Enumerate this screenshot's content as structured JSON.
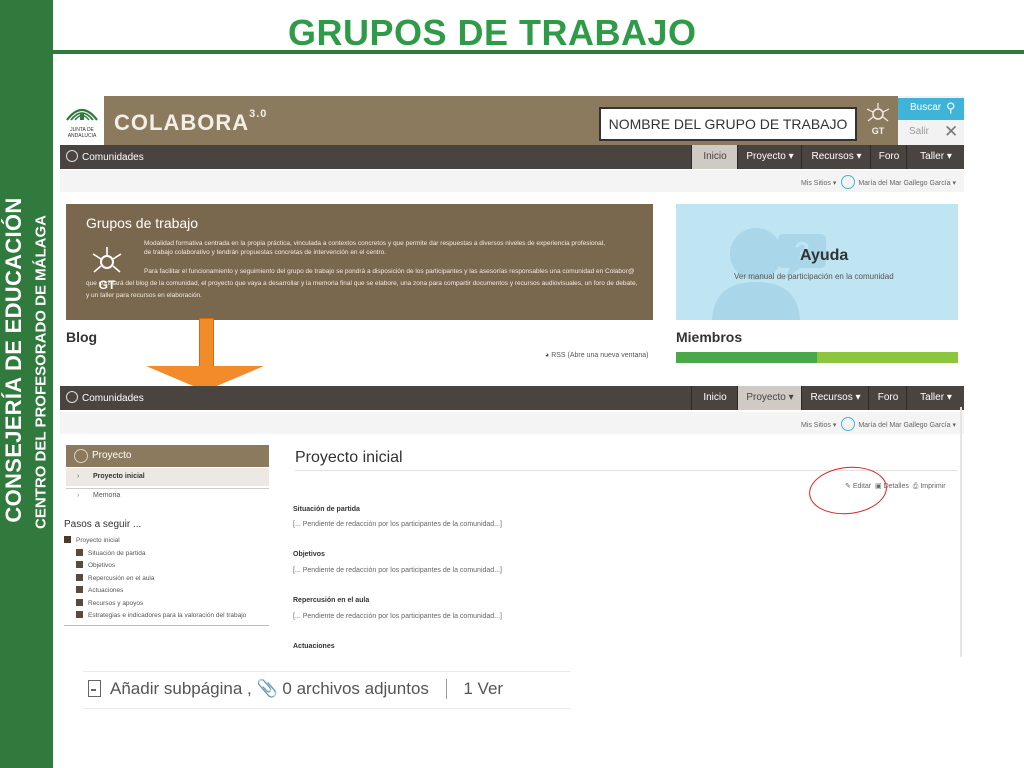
{
  "sidebar": {
    "line1": "CONSEJERÍA DE EDUCACIÓN",
    "line2": "CENTRO DEL PROFESORADO DE MÁLAGA"
  },
  "slide_title": "GRUPOS DE TRABAJO",
  "header": {
    "logo_text": "JUNTA DE ANDALUCIA",
    "brand": "COLABORA",
    "brand_version": "3.0",
    "group_name": "NOMBRE DEL GRUPO DE TRABAJO",
    "gt_label": "GT",
    "search_label": "Buscar",
    "logout_label": "Salir"
  },
  "nav": {
    "left": "Comunidades",
    "items": [
      "Inicio",
      "Proyecto ▾",
      "Recursos ▾",
      "Foro",
      "Taller ▾"
    ]
  },
  "user_bar": {
    "sites": "Mis Sitios ▾",
    "user": "María del Mar Gallego García ▾"
  },
  "banner": {
    "title": "Grupos de trabajo",
    "gt_label": "GT",
    "paragraph1": "Modalidad formativa centrada en la propia práctica, vinculada a contextos concretos y que permite dar respuestas a diversos niveles de experiencia profesional, de trabajo colaborativo y tendrán propuestas concretas de intervención en el centro.",
    "paragraph2": "Para facilitar el funcionamiento y seguimiento del grupo de trabajo se pondrá a disposición de los participantes y las asesorías responsables una comunidad en Colabor@ que constará del blog de la comunidad, el proyecto que vaya a desarrollar y la memoria final que se elabore, una zona para compartir documentos y recursos audiovisuales, un foro de debate, y un taller para recursos en elaboración."
  },
  "help": {
    "title": "Ayuda",
    "subtitle": "Ver manual de participación en la comunidad"
  },
  "blog_label": "Blog",
  "rss_label": "RSS (Abre una nueva ventana)",
  "members_label": "Miembros",
  "project_nav": {
    "header": "Proyecto",
    "items": [
      "Proyecto inicial",
      "Memoria"
    ]
  },
  "steps": {
    "title": "Pasos a seguir ...",
    "root": "Proyecto inicial",
    "items": [
      "Situación de partida",
      "Objetivos",
      "Repercusión en el aula",
      "Actuaciones",
      "Recursos y apoyos",
      "Estrategias e indicadores para la valoración del trabajo"
    ]
  },
  "content": {
    "title": "Proyecto inicial",
    "actions": {
      "edit": "Editar",
      "details": "Detalles",
      "print": "Imprimir"
    },
    "sections": [
      {
        "heading": "Situación de partida",
        "text": "[... Pendiente de redacción por los participantes de la comunidad...]"
      },
      {
        "heading": "Objetivos",
        "text": "[... Pendiente de redacción por los participantes de la comunidad...]"
      },
      {
        "heading": "Repercusión en el aula",
        "text": "[... Pendiente de redacción por los participantes de la comunidad...]"
      },
      {
        "heading": "Actuaciones",
        "text": ""
      }
    ]
  },
  "bottom": {
    "add_subpage": "Añadir subpágina ,",
    "attachments": "0 archivos adjuntos",
    "views": "1 Ver"
  },
  "colors": {
    "sidebar_green": "#2f7a3c",
    "title_green": "#2f9a48",
    "header_brown": "#8c7a5e",
    "nav_dark": "#4a4440",
    "accent_blue": "#3fb4d8",
    "arrow_orange": "#f28c2a",
    "circle_red": "#d22222"
  }
}
